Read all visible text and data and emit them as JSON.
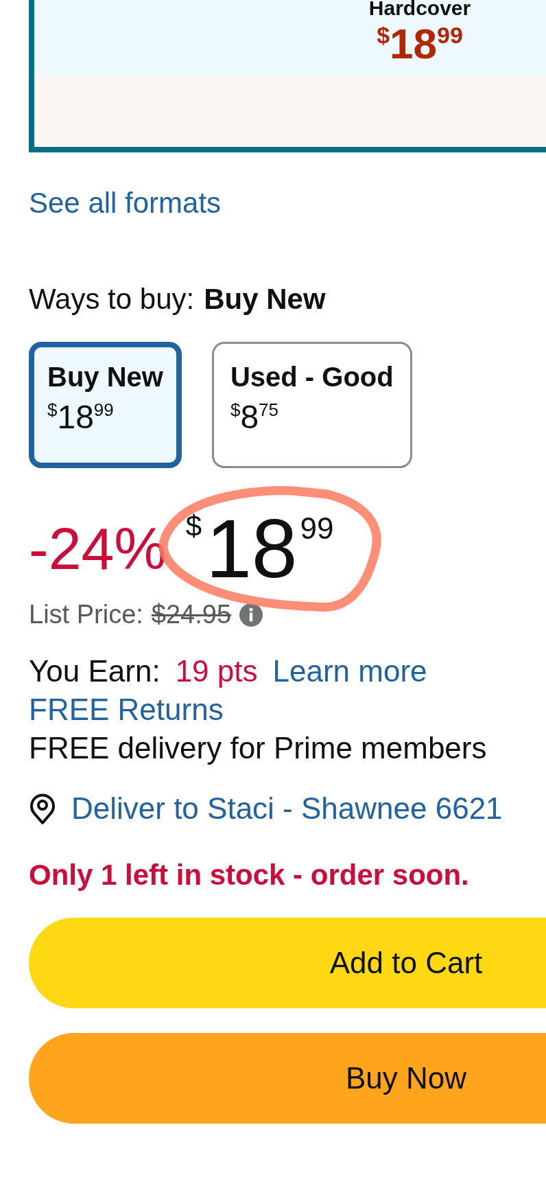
{
  "format_card": {
    "title": "Hardcover",
    "price": {
      "symbol": "$",
      "whole": "18",
      "fraction": "99"
    }
  },
  "see_all_formats": "See all formats",
  "ways_to_buy": {
    "label": "Ways to buy:",
    "value": "Buy New"
  },
  "options": [
    {
      "title": "Buy New",
      "price": {
        "symbol": "$",
        "whole": "18",
        "fraction": "99"
      },
      "selected": true
    },
    {
      "title": "Used - Good",
      "price": {
        "symbol": "$",
        "whole": "8",
        "fraction": "75"
      },
      "selected": false
    }
  ],
  "discount": "-24%",
  "price": {
    "symbol": "$",
    "whole": "18",
    "fraction": "99"
  },
  "list_price": {
    "label": "List Price:",
    "value": "$24.95"
  },
  "earn": {
    "label": "You Earn:",
    "points": "19 pts",
    "link": "Learn more"
  },
  "free_returns": "FREE Returns",
  "delivery": "FREE delivery for Prime members",
  "deliver_to": "Deliver to Staci - Shawnee 6621",
  "stock": "Only 1 left in stock - order soon.",
  "buttons": [
    {
      "label": "Add to Cart",
      "kind": "cart"
    },
    {
      "label": "Buy Now",
      "kind": "buy"
    }
  ]
}
